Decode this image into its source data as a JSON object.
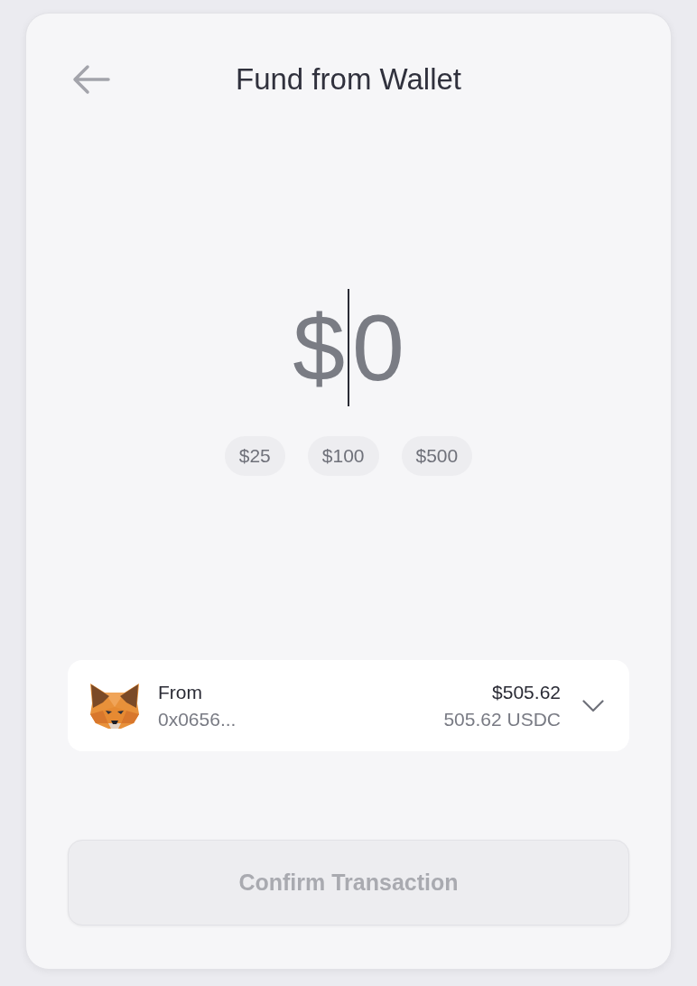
{
  "header": {
    "title": "Fund from Wallet"
  },
  "amount": {
    "prefix": "$",
    "placeholder": "0",
    "focused": true
  },
  "presets": [
    {
      "label": "$25"
    },
    {
      "label": "$100"
    },
    {
      "label": "$500"
    }
  ],
  "source": {
    "label": "From",
    "address": "0x0656...",
    "balance": "$505.62",
    "token_balance": "505.62 USDC"
  },
  "confirm_button": {
    "label": "Confirm Transaction",
    "disabled": true
  }
}
